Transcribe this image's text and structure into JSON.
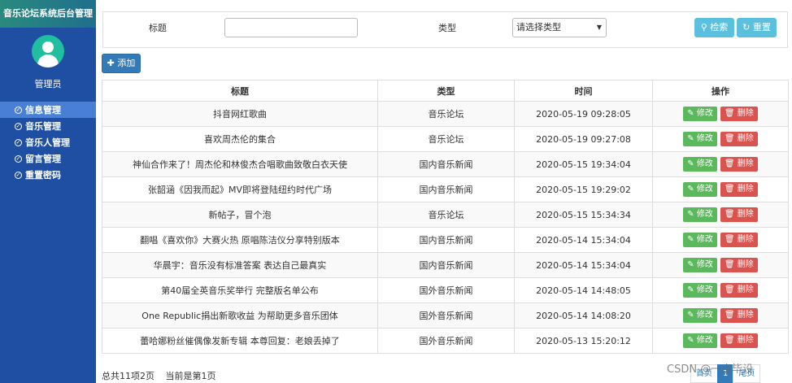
{
  "sidebar": {
    "title": "音乐论坛系统后台管理",
    "admin": "管理员",
    "items": [
      {
        "label": "信息管理",
        "active": true
      },
      {
        "label": "音乐管理",
        "active": false
      },
      {
        "label": "音乐人管理",
        "active": false
      },
      {
        "label": "留言管理",
        "active": false
      },
      {
        "label": "重置密码",
        "active": false
      }
    ]
  },
  "search": {
    "title_label": "标题",
    "type_label": "类型",
    "type_placeholder": "请选择类型",
    "search_label": "检索",
    "reset_label": "重置"
  },
  "toolbar": {
    "add_label": "添加"
  },
  "table": {
    "columns": [
      "标题",
      "类型",
      "时间",
      "操作"
    ],
    "edit_label": "修改",
    "delete_label": "删除",
    "rows": [
      {
        "title": "抖音网红歌曲",
        "type": "音乐论坛",
        "time": "2020-05-19 09:28:05"
      },
      {
        "title": "喜欢周杰伦的集合",
        "type": "音乐论坛",
        "time": "2020-05-19 09:27:08"
      },
      {
        "title": "神仙合作来了！周杰伦和林俊杰合唱歌曲致敬白衣天使",
        "type": "国内音乐新闻",
        "time": "2020-05-15 19:34:04"
      },
      {
        "title": "张韶涵《因我而起》MV即将登陆纽约时代广场",
        "type": "国内音乐新闻",
        "time": "2020-05-15 19:29:02"
      },
      {
        "title": "新帖子，冒个泡",
        "type": "音乐论坛",
        "time": "2020-05-15 15:34:34"
      },
      {
        "title": "翻唱《喜欢你》大赛火热 原唱陈洁仪分享特别版本",
        "type": "国内音乐新闻",
        "time": "2020-05-14 15:34:04"
      },
      {
        "title": "华晨宇：音乐没有标准答案 表达自己最真实",
        "type": "国内音乐新闻",
        "time": "2020-05-14 15:34:04"
      },
      {
        "title": "第40届全英音乐奖举行 完整版名单公布",
        "type": "国外音乐新闻",
        "time": "2020-05-14 14:48:05"
      },
      {
        "title": "One Republic捐出新歌收益 为帮助更多音乐团体",
        "type": "国外音乐新闻",
        "time": "2020-05-14 14:08:20"
      },
      {
        "title": "蕾哈娜粉丝催偶像发新专辑 本尊回复：老娘丢掉了",
        "type": "国外音乐新闻",
        "time": "2020-05-13 15:20:12"
      }
    ]
  },
  "footer": {
    "summary": "总共11项2页",
    "current": "当前是第1页"
  },
  "pager": [
    "首页",
    "1",
    "尾页"
  ],
  "watermark": "CSDN @一点毕设"
}
